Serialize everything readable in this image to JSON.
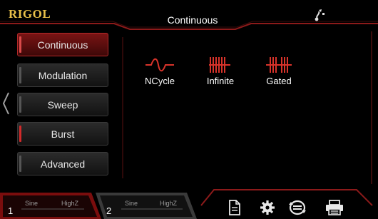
{
  "header": {
    "logo": "RIGOL",
    "title": "Continuous"
  },
  "sidebar": {
    "items": [
      {
        "label": "Continuous"
      },
      {
        "label": "Modulation"
      },
      {
        "label": "Sweep"
      },
      {
        "label": "Burst"
      },
      {
        "label": "Advanced"
      }
    ]
  },
  "modes": [
    {
      "label": "NCycle"
    },
    {
      "label": "Infinite"
    },
    {
      "label": "Gated"
    }
  ],
  "channels": [
    {
      "number": "1",
      "waveform": "Sine",
      "impedance": "HighZ"
    },
    {
      "number": "2",
      "waveform": "Sine",
      "impedance": "HighZ"
    }
  ],
  "colors": {
    "accent": "#c8102e",
    "logo": "#e8c04a",
    "active_tab": "#7a1414"
  },
  "icons": [
    "usb-icon",
    "left-arrow-icon",
    "document-icon",
    "gear-icon",
    "sync-icon",
    "printer-icon"
  ]
}
